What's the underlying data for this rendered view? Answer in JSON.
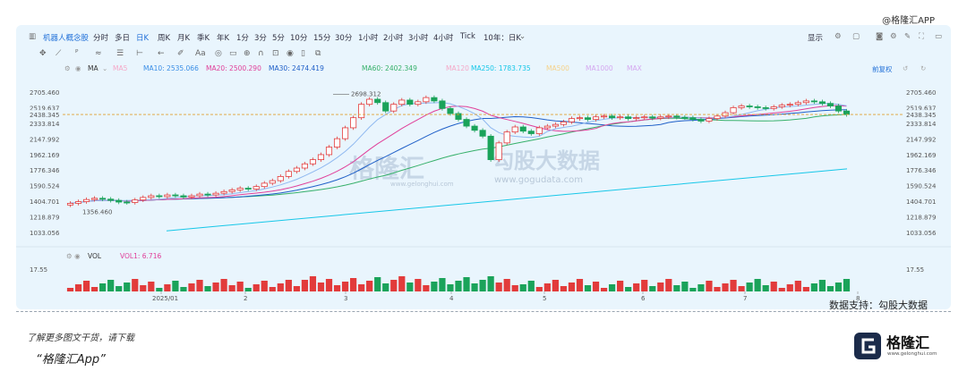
{
  "watermark_top": "@格隆汇APP",
  "toolbar": {
    "stock_name": "机器人概念股",
    "periods": [
      "分时",
      "多日",
      "日K",
      "周K",
      "月K",
      "季K",
      "年K",
      "1分",
      "3分",
      "5分",
      "10分",
      "15分",
      "30分",
      "1小时",
      "2小时",
      "3小时",
      "4小时",
      "Tick",
      "10年：日K"
    ],
    "active_period": "日K",
    "display_label": "显示",
    "adjust_label": "前复权"
  },
  "ma_legend": {
    "ma_label": "MA",
    "items": [
      {
        "text": "MA5",
        "color": "#f5a8c8"
      },
      {
        "text": "MA10: 2535.066",
        "color": "#3a8ee6"
      },
      {
        "text": "MA20: 2500.290",
        "color": "#e0409a"
      },
      {
        "text": "MA30: 2474.419",
        "color": "#2060c8"
      },
      {
        "text": "MA60: 2402.349",
        "color": "#36b06a"
      },
      {
        "text": "MA120",
        "color": "#f5a8c8"
      },
      {
        "text": "MA250: 1783.735",
        "color": "#16c7e8"
      },
      {
        "text": "MA500",
        "color": "#f5d28a"
      },
      {
        "text": "MA1000",
        "color": "#d5a8f0"
      },
      {
        "text": "MAX",
        "color": "#d5a8f0"
      }
    ]
  },
  "chart_data": {
    "type": "candlestick",
    "price_axis_ticks": [
      2705.46,
      2519.637,
      2333.814,
      2147.992,
      1962.169,
      1776.346,
      1590.524,
      1404.701,
      1218.879,
      1033.056
    ],
    "price_axis_ticks_text": [
      "2705.460",
      "2519.637",
      "2333.814",
      "2147.992",
      "1962.169",
      "1776.346",
      "1590.524",
      "1404.701",
      "1218.879",
      "1033.056"
    ],
    "ylim": [
      1033.056,
      2705.46
    ],
    "last_price": 2438.345,
    "last_price_text": "2438.345",
    "high_label": "2698.312",
    "high_value": 2698.312,
    "low_label": "1356.460",
    "low_value": 1356.46,
    "x_labels": [
      "2025/01",
      "2",
      "3",
      "4",
      "5",
      "6",
      "7",
      "8"
    ],
    "volume_label": "VOL",
    "volume_value_text": "VOL1: 6.716",
    "volume_axis_top": "17.55",
    "closes": [
      1380,
      1400,
      1425,
      1440,
      1430,
      1415,
      1395,
      1390,
      1420,
      1450,
      1470,
      1460,
      1480,
      1470,
      1455,
      1470,
      1490,
      1480,
      1500,
      1520,
      1540,
      1560,
      1550,
      1580,
      1620,
      1650,
      1700,
      1760,
      1800,
      1850,
      1900,
      1960,
      2050,
      2150,
      2280,
      2400,
      2560,
      2620,
      2580,
      2480,
      2560,
      2610,
      2560,
      2590,
      2640,
      2600,
      2510,
      2450,
      2380,
      2300,
      2250,
      2180,
      1900,
      2100,
      2230,
      2290,
      2240,
      2210,
      2280,
      2300,
      2320,
      2350,
      2390,
      2400,
      2380,
      2410,
      2420,
      2400,
      2410,
      2390,
      2400,
      2410,
      2395,
      2410,
      2420,
      2405,
      2400,
      2380,
      2360,
      2390,
      2420,
      2460,
      2520,
      2540,
      2530,
      2520,
      2510,
      2530,
      2550,
      2560,
      2580,
      2600,
      2590,
      2570,
      2540,
      2480,
      2438
    ],
    "ma_series_names": [
      "MA10",
      "MA20",
      "MA30",
      "MA60",
      "MA250"
    ]
  },
  "source_text": "数据支持：勾股大数据",
  "footer": {
    "note": "了解更多图文干货，请下载",
    "app": "“格隆汇App”",
    "logo_text": "格隆汇",
    "logo_url": "www.gelonghui.com"
  },
  "watermark_center": {
    "brand": "格隆汇",
    "brand2": "勾股大数据",
    "url": "www.gelonghui.com",
    "url2": "www.gogudata.com"
  }
}
